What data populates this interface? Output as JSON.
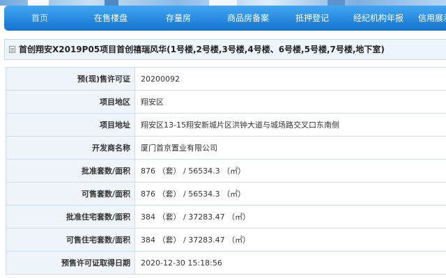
{
  "nav": {
    "items": [
      {
        "label": "首页",
        "active": true
      },
      {
        "label": "在售楼盘"
      },
      {
        "label": "存量房"
      },
      {
        "label": "商品房备案"
      },
      {
        "label": "抵押登记"
      },
      {
        "label": "经纪机构年报"
      },
      {
        "label": "信用展示"
      }
    ]
  },
  "page": {
    "title": "首创翔安X2019P05项目首创禧瑞风华(1号楼,2号楼,3号楼,4号楼、6号楼,5号楼,7号楼,地下室)"
  },
  "details": [
    {
      "label": "预(现)售许可证",
      "value": "20200092"
    },
    {
      "label": "项目地区",
      "value": "翔安区"
    },
    {
      "label": "项目地址",
      "value": "翔安区13-15翔安新城片区洪钟大道与城场路交叉口东南侧"
    },
    {
      "label": "开发商名称",
      "value": "厦门首京置业有限公司"
    },
    {
      "label": "批准套数/面积",
      "value": "876 （套） / 56534.3 （㎡）"
    },
    {
      "label": "可售套数/面积",
      "value": "876 （套） / 56534.3 （㎡）"
    },
    {
      "label": "批准住宅套数/面积",
      "value": "384 （套） / 37283.47 （㎡）"
    },
    {
      "label": "可售住宅套数/面积",
      "value": "384 （套） / 37283.47 （㎡）"
    },
    {
      "label": "预售许可证取得日期",
      "value": "2020-12-30 15:18:56"
    }
  ]
}
